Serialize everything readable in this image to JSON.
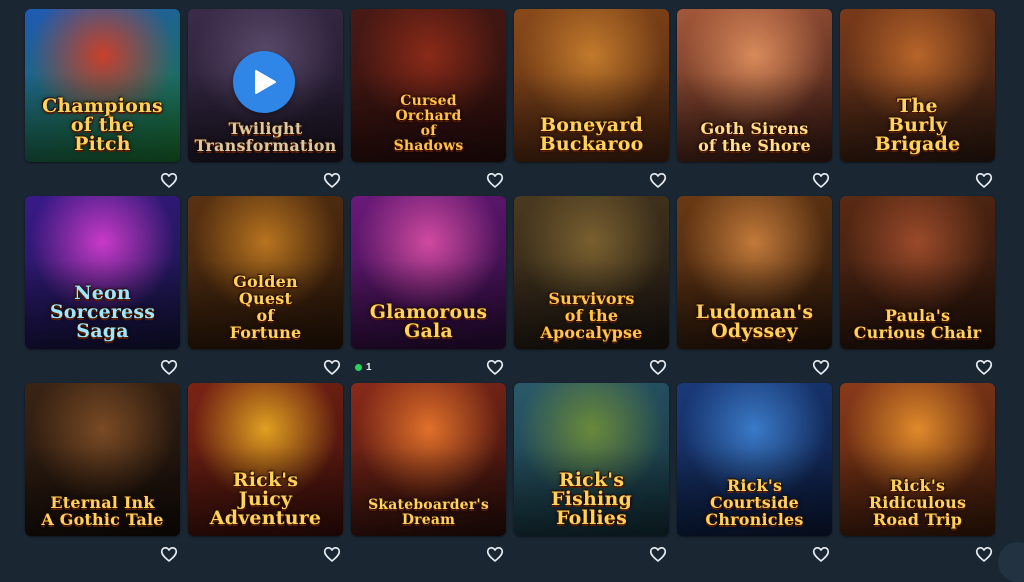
{
  "games": [
    {
      "id": "champions-of-the-pitch",
      "title": "Champions\nof the\nPitch",
      "colors": [
        "#1f5ab5",
        "#1b7a2f",
        "#c9402b"
      ],
      "title_color": "#ffd35a",
      "size": ""
    },
    {
      "id": "twilight-transformation",
      "title": "Twilight\nTransformation",
      "colors": [
        "#3b2c4a",
        "#1c1626",
        "#5a4a6a"
      ],
      "title_color": "#d8c9a2",
      "size": "small"
    },
    {
      "id": "cursed-orchard-of-shadows",
      "title": "Cursed\nOrchard\nof\nShadows",
      "colors": [
        "#4a1a14",
        "#2a0d0c",
        "#8a2a18"
      ],
      "title_color": "#ffc24a",
      "size": "tiny"
    },
    {
      "id": "boneyard-buckaroo",
      "title": "Boneyard\nBuckaroo",
      "colors": [
        "#8a4a1a",
        "#4a2410",
        "#c27a2c"
      ],
      "title_color": "#ffd35a",
      "size": ""
    },
    {
      "id": "goth-sirens-of-the-shore",
      "title": "Goth Sirens\nof the Shore",
      "colors": [
        "#a4583a",
        "#3a1a14",
        "#d98a5a"
      ],
      "title_color": "#ffe08a",
      "size": "small"
    },
    {
      "id": "the-burly-brigade",
      "title": "The\nBurly\nBrigade",
      "colors": [
        "#7a3a1a",
        "#2f1a10",
        "#b8652a"
      ],
      "title_color": "#ffd35a",
      "size": ""
    },
    {
      "id": "neon-sorceress-saga",
      "title": "Neon\nSorceress\nSaga",
      "colors": [
        "#3a1a8a",
        "#12143a",
        "#c83ac8"
      ],
      "title_color": "#9fe7ff",
      "size": ""
    },
    {
      "id": "golden-quest-of-fortune",
      "title": "Golden\nQuest\nof\nFortune",
      "colors": [
        "#5a3212",
        "#2a1608",
        "#b8741f"
      ],
      "title_color": "#ffd35a",
      "size": "small"
    },
    {
      "id": "glamorous-gala",
      "title": "Glamorous\nGala",
      "colors": [
        "#6a1a7a",
        "#2a0c3a",
        "#d04aa0"
      ],
      "title_color": "#ffd35a",
      "size": ""
    },
    {
      "id": "survivors-of-the-apocalypse",
      "title": "Survivors\nof the\nApocalypse",
      "colors": [
        "#4a3a20",
        "#1c1610",
        "#7a6030"
      ],
      "title_color": "#ffc64a",
      "size": "small"
    },
    {
      "id": "ludomans-odyssey",
      "title": "Ludoman's\nOdyssey",
      "colors": [
        "#6a3a14",
        "#2a160a",
        "#c27a3a"
      ],
      "title_color": "#ffd35a",
      "size": ""
    },
    {
      "id": "paulas-curious-chair",
      "title": "Paula's\nCurious Chair",
      "colors": [
        "#5a2a14",
        "#24120a",
        "#9a4a2a"
      ],
      "title_color": "#ffd35a",
      "size": "small"
    },
    {
      "id": "eternal-ink",
      "title": "Eternal Ink\nA Gothic Tale",
      "colors": [
        "#3a2414",
        "#140c08",
        "#7a4a24"
      ],
      "title_color": "#ffd35a",
      "size": "small"
    },
    {
      "id": "ricks-juicy-adventure",
      "title": "Rick's\nJuicy\nAdventure",
      "colors": [
        "#7a2414",
        "#3a0e0a",
        "#e0a020"
      ],
      "title_color": "#ffd35a",
      "size": ""
    },
    {
      "id": "skateboarders-dream",
      "title": "Skateboarder's\nDream",
      "colors": [
        "#8a2a1a",
        "#2a0e0a",
        "#e0702a"
      ],
      "title_color": "#ffd35a",
      "size": "tiny"
    },
    {
      "id": "ricks-fishing-follies",
      "title": "Rick's\nFishing\nFollies",
      "colors": [
        "#2a5a6a",
        "#14303a",
        "#6a8a3a"
      ],
      "title_color": "#ffd35a",
      "size": ""
    },
    {
      "id": "ricks-courtside-chronicles",
      "title": "Rick's\nCourtside\nChronicles",
      "colors": [
        "#1a3a7a",
        "#0c1a3a",
        "#3a7ac8"
      ],
      "title_color": "#ffd35a",
      "size": "small"
    },
    {
      "id": "ricks-ridiculous-road-trip",
      "title": "Rick's\nRidiculous\nRoad Trip",
      "colors": [
        "#8a3a1a",
        "#3a1a0a",
        "#e08a2a"
      ],
      "title_color": "#ffd35a",
      "size": "small"
    }
  ],
  "hover_play": {
    "game_index": 1,
    "icon": "play-icon",
    "color": "#2f86e6"
  },
  "online_badge": {
    "game_index": 8,
    "count": "1",
    "color": "#27d15a"
  },
  "favorite_icon": "heart-outline-icon",
  "scroll_button_icon": "scroll-icon"
}
